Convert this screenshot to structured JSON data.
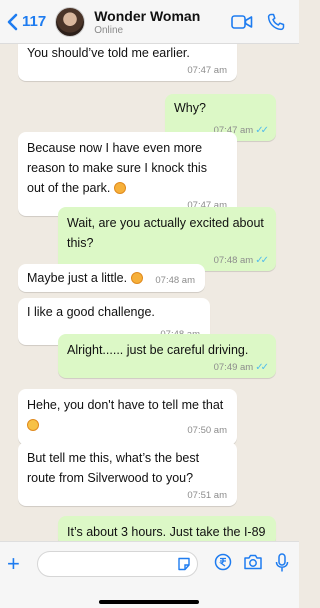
{
  "header": {
    "back_count": "117",
    "contact_name": "Wonder Woman",
    "status": "Online"
  },
  "messages": [
    {
      "dir": "in",
      "text": "You should’ve told me earlier.",
      "time": "07:47 am"
    },
    {
      "dir": "out",
      "text": "Why?",
      "time": "07:47 am"
    },
    {
      "dir": "in",
      "text": "Because now I have even more reason to make sure I knock this out of the park.",
      "time": "07:47 am"
    },
    {
      "dir": "out",
      "text": "Wait, are you actually excited about this?",
      "time": "07:48 am"
    },
    {
      "dir": "in",
      "text": "Maybe just a little.",
      "time": "07:48 am"
    },
    {
      "dir": "in",
      "text": "I like a good challenge.",
      "time": "07:48 am"
    },
    {
      "dir": "out",
      "text": "Alright...... just be careful driving.",
      "time": "07:49 am"
    },
    {
      "dir": "in",
      "text": "Hehe, you don't have to tell me that",
      "time": "07:50 am"
    },
    {
      "dir": "in",
      "text": "But tell me this, what’s the best route from Silverwood to you?",
      "time": "07:51 am"
    },
    {
      "dir": "out",
      "text": "It’s about 3 hours. Just take the I-89",
      "time": ""
    }
  ],
  "colors": {
    "accent": "#1e7cf0",
    "outgoing_bubble": "#dcf8c6",
    "incoming_bubble": "#ffffff",
    "background": "#efeae2",
    "read_tick": "#53bdeb"
  },
  "icons": [
    "chevron-left-icon",
    "video-camera-icon",
    "phone-icon",
    "plus-icon",
    "sticker-icon",
    "rupee-icon",
    "camera-icon",
    "microphone-icon"
  ]
}
